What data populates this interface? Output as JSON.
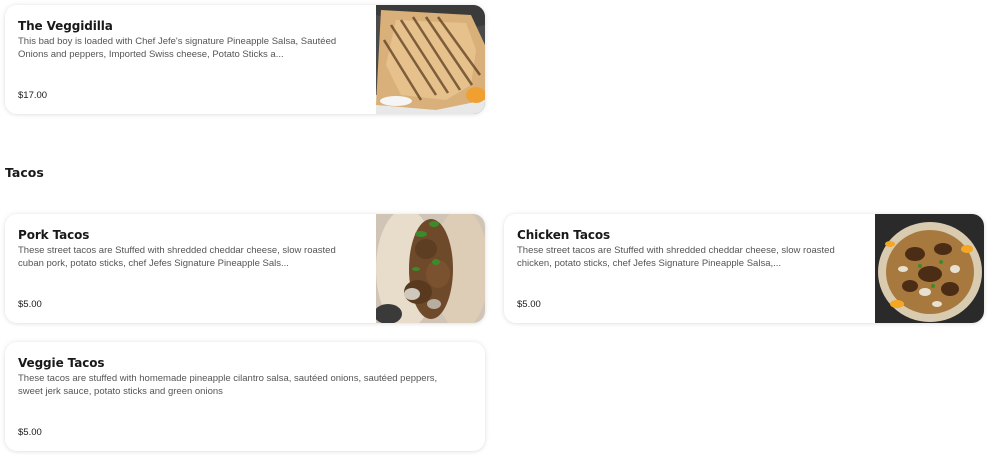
{
  "items": {
    "veggidilla": {
      "name": "The Veggidilla",
      "description": "This bad boy is loaded with Chef Jefe's signature Pineapple Salsa, Sautéed Onions and peppers, Imported Swiss cheese, Potato Sticks a...",
      "price": "$17.00"
    },
    "pork_tacos": {
      "name": "Pork Tacos",
      "description": "These street tacos are Stuffed with shredded cheddar cheese, slow roasted cuban pork, potato sticks, chef Jefes Signature Pineapple Sals...",
      "price": "$5.00"
    },
    "chicken_tacos": {
      "name": "Chicken Tacos",
      "description": "These street tacos are Stuffed with shredded cheddar cheese, slow roasted chicken, potato sticks, chef Jefes Signature Pineapple Salsa,...",
      "price": "$5.00"
    },
    "veggie_tacos": {
      "name": "Veggie Tacos",
      "description": "These tacos are stuffed with homemade pineapple cilantro salsa, sautéed onions, sautéed peppers, sweet jerk sauce, potato sticks and green onions",
      "price": "$5.00"
    }
  },
  "sections": {
    "tacos": {
      "title": "Tacos"
    }
  },
  "colors": {
    "text": "#191919",
    "description": "#555555",
    "card_background": "#ffffff"
  }
}
